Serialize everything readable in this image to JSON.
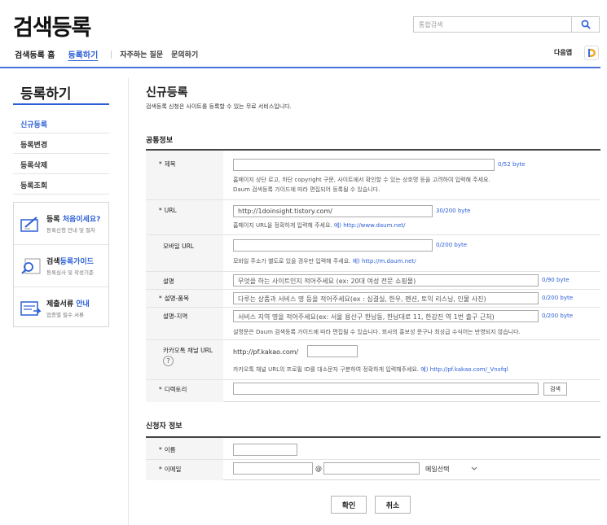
{
  "header": {
    "logo": "검색등록",
    "search_placeholder": "통합검색",
    "nav": {
      "home": "검색등록 홈",
      "register": "등록하기",
      "faq": "자주하는 질문",
      "inquiry": "문의하기"
    },
    "daum_app": "다음앱"
  },
  "sidebar": {
    "title": "등록하기",
    "items": [
      "신규등록",
      "등록변경",
      "등록삭제",
      "등록조회"
    ],
    "boxes": [
      {
        "title_a": "등록 ",
        "title_hl": "처음이세요?",
        "sub": "등록신청 안내 및 절차"
      },
      {
        "title_a": "검색",
        "title_hl": "등록가이드",
        "sub": "등록심사 및 작성기준"
      },
      {
        "title_a": "제출서류 ",
        "title_hl": "안내",
        "sub": "업종별 필수 서류"
      }
    ]
  },
  "main": {
    "title": "신규등록",
    "desc": "검색등록 신청은 사이트를 등록할 수 있는 무료 서비스입니다.",
    "common_title": "공통정보",
    "fields": {
      "title": {
        "label": "제목",
        "byte": "0/52 byte",
        "help1": "홈페이지 상단 로고, 하단 copyright 구문, 사이트에서 확인할 수 있는 상호명 등을 고려하여 입력해 주세요.",
        "help2": "Daum 검색등록 가이드에 따라 편집되어 등록될 수 있습니다."
      },
      "url": {
        "label": "URL",
        "value": "http://1doinsight.tistory.com/",
        "byte": "30/200 byte",
        "help": "홈페이지 URL을 정확하게 입력해 주세요. ",
        "help_link": "예) http://www.daum.net/"
      },
      "mobile": {
        "label": "모바일 URL",
        "byte": "0/200 byte",
        "help": "모바일 주소가 별도로 있을 경우만 입력해 주세요. ",
        "help_link": "예) http://m.daum.net/"
      },
      "desc": {
        "label": "설명",
        "placeholder": "무엇을 하는 사이트인지 적어주세요 (ex: 20대 여성 전문 쇼핑몰)",
        "byte": "0/90 byte"
      },
      "desc_item": {
        "label": "설명-품목",
        "placeholder": "다루는 상품과 서비스 명 등을 적어주세요(ex : 심결실, 한우, 펜션, 토익 리스닝, 인물 사진)",
        "byte": "0/200 byte"
      },
      "desc_region": {
        "label": "설명-지역",
        "placeholder": "서비스 지역 명을 적어주세요(ex: 서울  용산구 한남동, 한남대로 11, 한강진 역 1번 출구 근처)",
        "byte": "0/200 byte",
        "help": "설명문은 Daum 검색등록 가이드에 따라 편집될 수 있습니다. 회사의 홍보성 문구나 최상급 수식어는 반영되지 않습니다."
      },
      "kakao": {
        "label": "카카오톡 채널 URL",
        "prefix": "http://pf.kakao.com/",
        "qmark": "?",
        "help": "카카오톡 채널 URL의 프로필 ID를 대소문자 구분하여 정확하게 입력해주세요. ",
        "help_link": "예) http://pf.kakao.com/_Vnxfql"
      },
      "directory": {
        "label": "디렉토리",
        "button": "검색"
      }
    },
    "applicant_title": "신청자 정보",
    "applicant": {
      "name_label": "이름",
      "email_label": "이메일",
      "at": "@",
      "email_select": "메일선택"
    },
    "buttons": {
      "confirm": "확인",
      "cancel": "취소"
    },
    "star": "*"
  },
  "colors": {
    "accent": "#2c5fd6",
    "nav_line": "#4a6fd6"
  }
}
